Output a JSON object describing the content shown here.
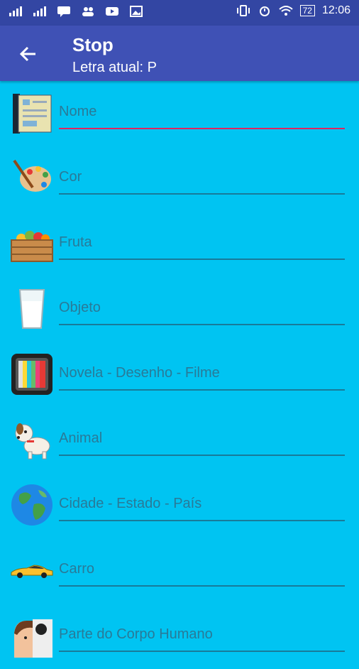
{
  "status_bar": {
    "time": "12:06",
    "battery": "72"
  },
  "app_bar": {
    "title": "Stop",
    "subtitle": "Letra atual: P"
  },
  "fields": [
    {
      "placeholder": "Nome",
      "icon": "book-icon",
      "active": true
    },
    {
      "placeholder": "Cor",
      "icon": "palette-icon",
      "active": false
    },
    {
      "placeholder": "Fruta",
      "icon": "fruit-crate-icon",
      "active": false
    },
    {
      "placeholder": "Objeto",
      "icon": "glass-icon",
      "active": false
    },
    {
      "placeholder": "Novela - Desenho - Filme",
      "icon": "tv-icon",
      "active": false
    },
    {
      "placeholder": "Animal",
      "icon": "dog-icon",
      "active": false
    },
    {
      "placeholder": "Cidade - Estado - País",
      "icon": "globe-icon",
      "active": false
    },
    {
      "placeholder": "Carro",
      "icon": "car-icon",
      "active": false
    },
    {
      "placeholder": "Parte do Corpo Humano",
      "icon": "human-face-icon",
      "active": false
    }
  ],
  "colors": {
    "background": "#00c4f2",
    "app_bar": "#3f51b5",
    "status_bar": "#3346a3",
    "accent": "#e0245e"
  }
}
